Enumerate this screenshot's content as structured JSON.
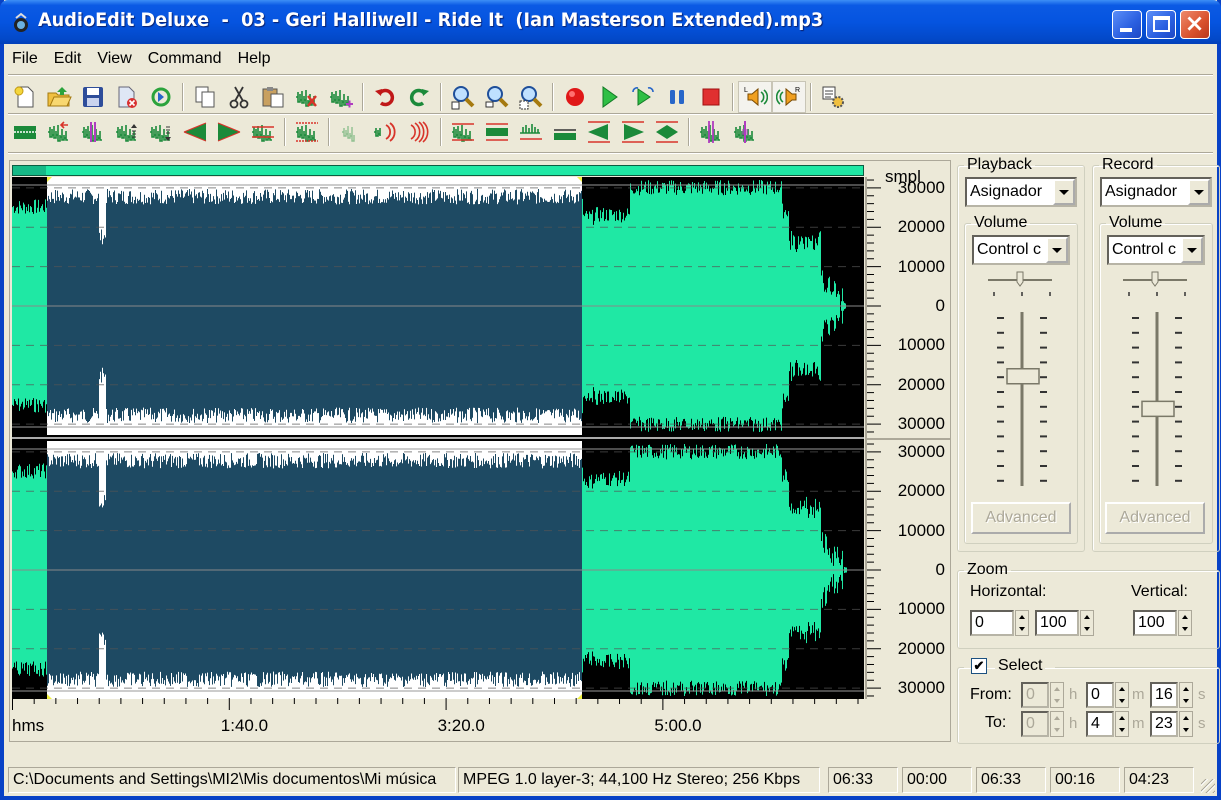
{
  "window": {
    "title": "AudioEdit Deluxe  -  03 - Geri Halliwell - Ride It  (Ian Masterson Extended).mp3",
    "controls": [
      "minimize",
      "maximize",
      "close"
    ]
  },
  "menu": [
    "File",
    "Edit",
    "View",
    "Command",
    "Help"
  ],
  "toolbar1": [
    {
      "icon": "new-file-icon",
      "label": "New"
    },
    {
      "icon": "open-folder-icon",
      "label": "Open"
    },
    {
      "icon": "save-icon",
      "label": "Save"
    },
    {
      "icon": "close-file-icon",
      "label": "Close"
    },
    {
      "icon": "convert-icon",
      "label": "Convert"
    },
    {
      "sep": true
    },
    {
      "icon": "copy-icon",
      "label": "Copy"
    },
    {
      "icon": "cut-icon",
      "label": "Cut"
    },
    {
      "icon": "paste-icon",
      "label": "Paste"
    },
    {
      "icon": "delete-selection-icon",
      "label": "Delete"
    },
    {
      "icon": "paste-mix-icon",
      "label": "Mix Paste"
    },
    {
      "sep": true
    },
    {
      "icon": "undo-icon",
      "label": "Undo"
    },
    {
      "icon": "redo-icon",
      "label": "Redo"
    },
    {
      "sep": true
    },
    {
      "icon": "zoom-in-icon",
      "label": "Zoom In"
    },
    {
      "icon": "zoom-out-icon",
      "label": "Zoom Out"
    },
    {
      "icon": "zoom-selection-icon",
      "label": "Zoom Selection"
    },
    {
      "sep": true
    },
    {
      "icon": "record-icon",
      "label": "Record"
    },
    {
      "icon": "play-icon",
      "label": "Play"
    },
    {
      "icon": "play-loop-icon",
      "label": "Play Loop"
    },
    {
      "icon": "pause-icon",
      "label": "Pause"
    },
    {
      "icon": "stop-icon",
      "label": "Stop"
    },
    {
      "sep": true
    },
    {
      "icon": "left-channel-icon",
      "label": "Left Channel",
      "pressed": true
    },
    {
      "icon": "right-channel-icon",
      "label": "Right Channel",
      "pressed": true
    },
    {
      "sep": true
    },
    {
      "icon": "settings-icon",
      "label": "Settings"
    }
  ],
  "toolbar2": [
    {
      "icon": "normalize-icon"
    },
    {
      "icon": "reverse-icon"
    },
    {
      "icon": "insert-silence-icon"
    },
    {
      "icon": "amplify-icon"
    },
    {
      "icon": "attenuate-icon"
    },
    {
      "icon": "fade-in-icon"
    },
    {
      "icon": "fade-out-icon"
    },
    {
      "icon": "noise-gate-icon"
    },
    {
      "sep": true
    },
    {
      "icon": "stretch-icon"
    },
    {
      "sep": true
    },
    {
      "icon": "chorus-icon"
    },
    {
      "icon": "echo-icon"
    },
    {
      "icon": "reverb-icon"
    },
    {
      "sep": true
    },
    {
      "icon": "band-filter-icon"
    },
    {
      "icon": "low-pass-icon"
    },
    {
      "icon": "high-pass-icon"
    },
    {
      "icon": "equalizer-icon"
    },
    {
      "icon": "pitch-down-icon"
    },
    {
      "icon": "pitch-up-icon"
    },
    {
      "icon": "compress-icon"
    },
    {
      "sep": true
    },
    {
      "icon": "split-marker-icon"
    },
    {
      "icon": "marker-icon"
    }
  ],
  "waveform": {
    "y_unit": "smpl",
    "channel1_labels": [
      "30000",
      "20000",
      "10000",
      "0",
      "10000",
      "20000",
      "30000"
    ],
    "channel2_labels": [
      "30000",
      "20000",
      "10000",
      "0",
      "10000",
      "20000",
      "30000"
    ],
    "x_unit": "hms",
    "x_labels": [
      "1:40.0",
      "3:20.0",
      "5:00.0"
    ],
    "selection_start_s": 16,
    "selection_end_s": 263,
    "total_s": 393,
    "colors": {
      "wave": "#1fe8a4",
      "wave_selected": "#1e4a63",
      "bg": "#000000",
      "bg_selected": "#ffffff"
    }
  },
  "playback": {
    "title": "Playback",
    "device": "Asignador",
    "volume_title": "Volume",
    "volume_control": "Control c",
    "volume_level": 0.75,
    "balance": 0.5,
    "advanced_label": "Advanced"
  },
  "record": {
    "title": "Record",
    "device": "Asignador",
    "volume_title": "Volume",
    "volume_control": "Control c",
    "volume_level": 0.55,
    "balance": 0.5,
    "advanced_label": "Advanced"
  },
  "zoom": {
    "title": "Zoom",
    "horizontal_label": "Horizontal:",
    "vertical_label": "Vertical:",
    "h_from": "0",
    "h_to": "100",
    "vertical": "100"
  },
  "select": {
    "label": "Select",
    "checked": true,
    "from_label": "From:",
    "to_label": "To:",
    "from": {
      "h": "0",
      "m": "0",
      "s": "16"
    },
    "to": {
      "h": "0",
      "m": "4",
      "s": "23"
    },
    "units": {
      "h": "h",
      "m": "m",
      "s": "s"
    }
  },
  "status": {
    "path": "C:\\Documents and Settings\\MI2\\Mis documentos\\Mi música",
    "format": "MPEG 1.0 layer-3; 44,100 Hz Stereo;  256 Kbps",
    "duration": "06:33",
    "position": "00:00",
    "end": "06:33",
    "sel_start": "00:16",
    "sel_end": "04:23"
  }
}
